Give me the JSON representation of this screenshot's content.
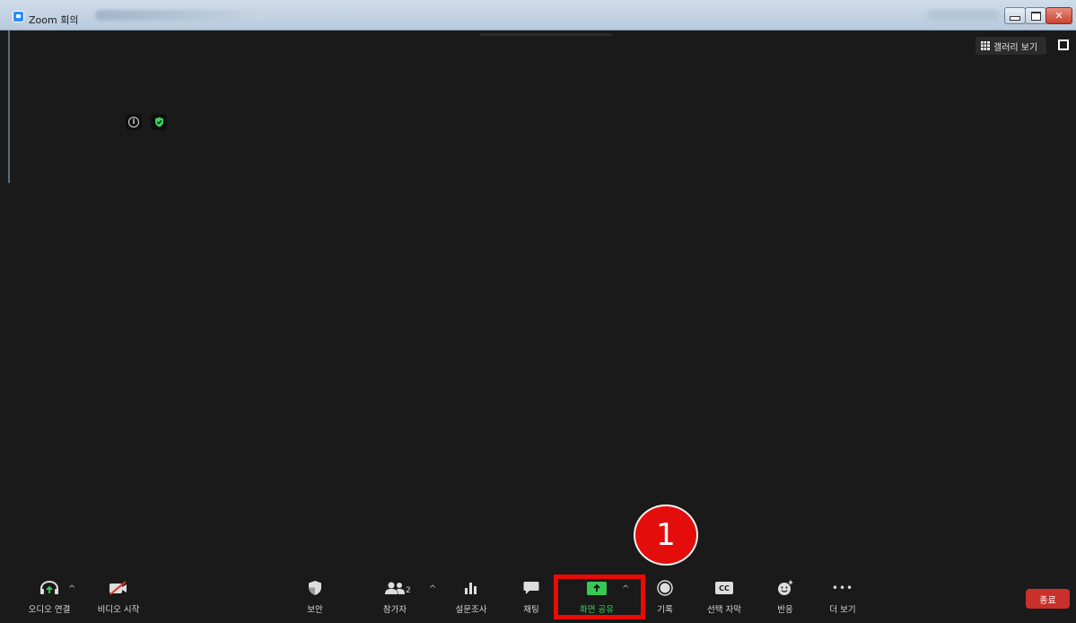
{
  "window": {
    "title": "Zoom 회의",
    "controls": [
      "minimize",
      "maximize",
      "close"
    ]
  },
  "header": {
    "gallery_view_label": "갤러리 보기"
  },
  "toolbar": {
    "audio_label": "오디오 연결",
    "video_label": "비디오 시작",
    "security_label": "보안",
    "participants_label": "참가자",
    "participants_count": "2",
    "polls_label": "설문조사",
    "chat_label": "채팅",
    "share_label": "화면 공유",
    "record_label": "기록",
    "captions_label": "선택 자막",
    "captions_icon_text": "CC",
    "reactions_label": "반응",
    "more_label": "더 보기",
    "more_icon_text": "•••",
    "end_label": "종료",
    "caret": "^"
  },
  "annotation": {
    "step_number": "1",
    "highlight_color": "#ea0b06"
  },
  "colors": {
    "background": "#1a1a1a",
    "share_green": "#39c856",
    "end_red": "#c9302c",
    "encryption_green": "#39d05c"
  }
}
